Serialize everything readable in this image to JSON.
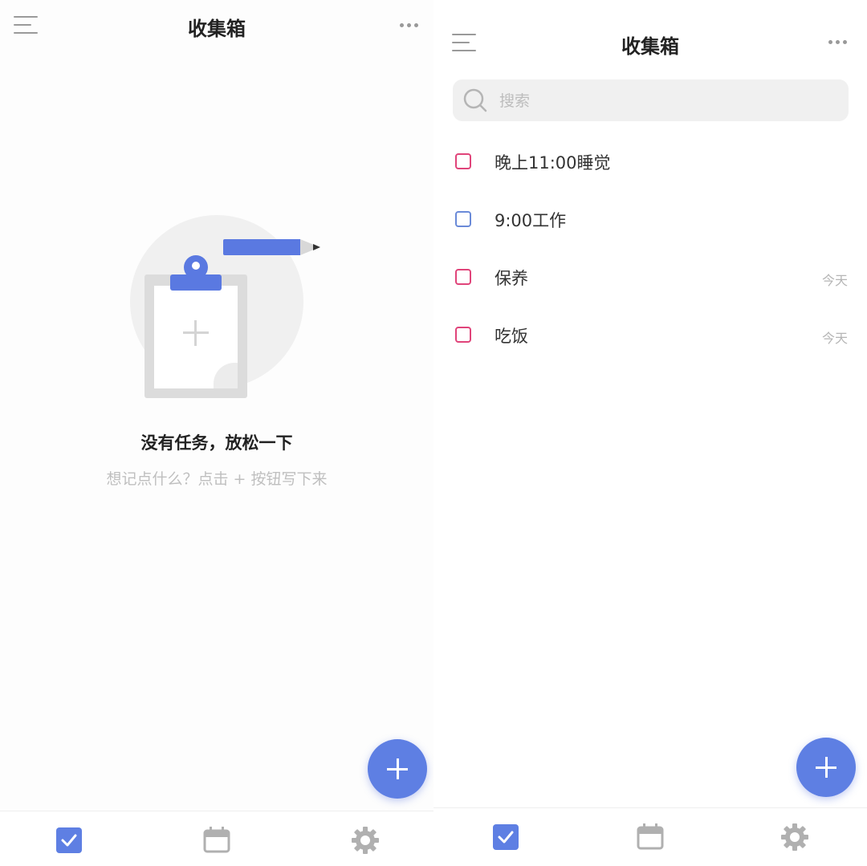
{
  "colors": {
    "accent": "#5e7fe3",
    "priority_high": "#e0447a",
    "priority_normal": "#6a8ad8",
    "muted_text": "#bfbfbf"
  },
  "left_screen": {
    "header": {
      "menu_icon": "menu-lines-icon",
      "title": "收集箱",
      "more_icon": "more-horizontal-icon"
    },
    "empty_state": {
      "illustration": "clipboard-pencil-illustration",
      "title": "没有任务，放松一下",
      "subtitle": "想记点什么？点击 + 按钮写下来"
    },
    "fab": {
      "icon": "plus-icon"
    },
    "tabbar": [
      {
        "icon": "checkbox-checked-icon",
        "active": true
      },
      {
        "icon": "calendar-icon",
        "active": false
      },
      {
        "icon": "gear-icon",
        "active": false
      }
    ]
  },
  "right_screen": {
    "header": {
      "menu_icon": "menu-lines-icon",
      "title": "收集箱",
      "more_icon": "more-horizontal-icon"
    },
    "search": {
      "icon": "search-icon",
      "placeholder": "搜索",
      "value": ""
    },
    "tasks": [
      {
        "label": "晚上11:00睡觉",
        "date": "",
        "priority_color": "#e0447a"
      },
      {
        "label": "9:00工作",
        "date": "",
        "priority_color": "#6a8ad8"
      },
      {
        "label": "保养",
        "date": "今天",
        "priority_color": "#e0447a"
      },
      {
        "label": "吃饭",
        "date": "今天",
        "priority_color": "#e0447a"
      }
    ],
    "fab": {
      "icon": "plus-icon"
    },
    "tabbar": [
      {
        "icon": "checkbox-checked-icon",
        "active": true
      },
      {
        "icon": "calendar-icon",
        "active": false
      },
      {
        "icon": "gear-icon",
        "active": false
      }
    ]
  }
}
